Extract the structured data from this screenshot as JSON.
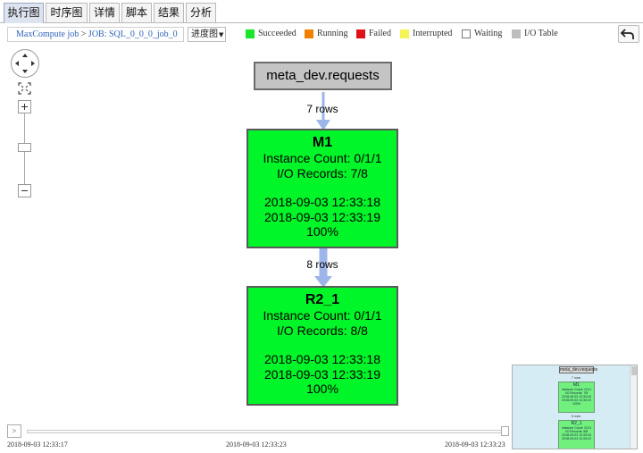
{
  "tabs": [
    {
      "label": "执行图",
      "active": true
    },
    {
      "label": "时序图",
      "active": false
    },
    {
      "label": "详情",
      "active": false
    },
    {
      "label": "脚本",
      "active": false
    },
    {
      "label": "结果",
      "active": false
    },
    {
      "label": "分析",
      "active": false
    }
  ],
  "breadcrumb": {
    "root": "MaxCompute job",
    "separator": ">",
    "current": "JOB: SQL_0_0_0_job_0"
  },
  "view_select": {
    "value": "进度图"
  },
  "legend": [
    {
      "label": "Succeeded",
      "color": "#19e62a"
    },
    {
      "label": "Running",
      "color": "#f08000"
    },
    {
      "label": "Failed",
      "color": "#e0101a"
    },
    {
      "label": "Interrupted",
      "color": "#f4f454"
    },
    {
      "label": "Waiting",
      "color": "#ffffff"
    },
    {
      "label": "I/O Table",
      "color": "#bdbdbd"
    }
  ],
  "graph": {
    "source_table": "meta_dev.requests",
    "edges": [
      {
        "label": "7 rows"
      },
      {
        "label": "8 rows"
      }
    ],
    "nodes": [
      {
        "name": "M1",
        "instance_count": "Instance Count: 0/1/1",
        "io_records": "I/O Records: 7/8",
        "start_time": "2018-09-03 12:33:18",
        "end_time": "2018-09-03 12:33:19",
        "progress": "100%",
        "status": "Succeeded"
      },
      {
        "name": "R2_1",
        "instance_count": "Instance Count: 0/1/1",
        "io_records": "I/O Records: 8/8",
        "start_time": "2018-09-03 12:33:18",
        "end_time": "2018-09-03 12:33:19",
        "progress": "100%",
        "status": "Succeeded"
      }
    ]
  },
  "timeline": {
    "play_label": ">",
    "ticks": [
      "2018-09-03 12:33:17",
      "2018-09-03 12:33:23",
      "2018-09-03 12:33:23"
    ]
  },
  "icons": {
    "back": "back-arrow-icon",
    "pan": "pan-control-icon",
    "fit": "fit-screen-icon",
    "zoom_in": "zoom-in-icon",
    "zoom_out": "zoom-out-icon"
  },
  "colors": {
    "node_fill": "#00f629",
    "table_fill": "#c4c4c4",
    "edge": "#9db5e8",
    "active_tab": "#dde4ef"
  }
}
